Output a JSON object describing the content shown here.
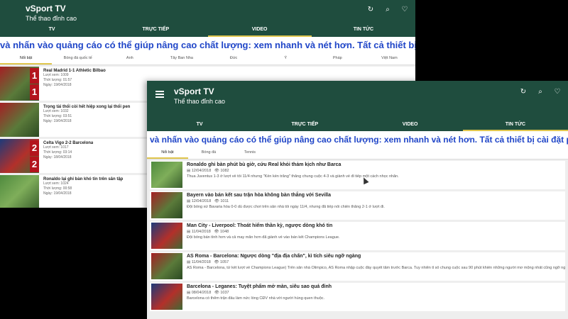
{
  "app": {
    "title": "vSport TV",
    "subtitle": "Thể thao đỉnh cao"
  },
  "icons": {
    "refresh": "↻",
    "search": "⌕",
    "favorite": "♡"
  },
  "colors": {
    "appbar": "#1f4d3e",
    "accent": "#e0c64d",
    "marquee": "#2046c8",
    "score": "#b3141d"
  },
  "tabs": [
    "TV",
    "TRỰC TIẾP",
    "VIDEO",
    "TIN TỨC"
  ],
  "back_window": {
    "active_tab": "VIDEO",
    "marquee": "và nhấn vào quảng cáo có thể giúp nâng cao chất lượng: xem nhanh và nét hơn. Tất cả thiết bị cài đặt phần mềm chặn q",
    "categories": [
      "Nổi bật",
      "Bóng đá quốc tế",
      "Anh",
      "Tây Ban Nha",
      "Đức",
      "Ý",
      "Pháp",
      "Việt Nam"
    ],
    "items": [
      {
        "title": "Real Madrid 1-1 Athletic Bilbao",
        "views": "Lượt xem: 1009",
        "duration": "Thời lượng: 01:57",
        "date": "Ngày: 19/04/2018"
      },
      {
        "title": "Trọng tài thổi còi hết hiệp xong lại thổi pen",
        "views": "Lượt xem: 1032",
        "duration": "Thời lượng: 03:51",
        "date": "Ngày: 19/04/2018"
      },
      {
        "title": "Celta Vigo 2-2 Barcelona",
        "views": "Lượt xem: 1017",
        "duration": "Thời lượng: 03:14",
        "date": "Ngày: 18/04/2018",
        "score_top": "2",
        "score_bottom": "2"
      },
      {
        "title": "Ronaldo lại ghi bàn khó tin trên sân tập",
        "views": "Lượt xem: 1024",
        "duration": "Thời lượng: 00:58",
        "date": "Ngày: 19/04/2018"
      }
    ],
    "first_item_score": {
      "top": "1",
      "bottom": "1"
    }
  },
  "front_window": {
    "active_tab": "TIN TỨC",
    "marquee": "và nhấn vào quảng cáo có thể giúp nâng cao chất lượng: xem nhanh và nét hơn. Tất cả thiết bị cài đặt phần mềm chặn q",
    "categories": [
      "Nổi bật",
      "Bóng đá",
      "Tennis"
    ],
    "items": [
      {
        "title": "Ronaldo ghi bàn phút bù giờ, cứu Real khỏi thảm kịch như Barca",
        "date": "12/04/2018",
        "views": "1082",
        "desc": "Thua Juventus 1-3 ở lượt về tối 11/4 nhưng \"Kền kền trắng\" thắng chung cuộc 4-3 và giành vé đi tiếp một cách nhọc nhằn."
      },
      {
        "title": "Bayern vào bán kết sau trận hòa không bàn thắng với Sevilla",
        "date": "12/04/2018",
        "views": "1011",
        "desc": "Đội bóng xứ Bavaria hòa 0-0 dù được chơi trên sân nhà tối ngày 11/4, nhưng đã tiếp nối chiến thắng 2-1 ở lượt đi."
      },
      {
        "title": "Man City - Liverpool: Thoát hiểm thần kỳ, ngược dòng khó tin",
        "date": "11/04/2018",
        "views": "1048",
        "desc": "Đội bóng bán tính hơn và cả may mắn hơn đã giành vé vào bán kết Champions League."
      },
      {
        "title": "AS Roma - Barcelona: Ngược dòng \"địa địa chấn\", kì tích siêu ngỡ ngàng",
        "date": "11/04/2018",
        "views": "1057",
        "desc": "AS Roma - Barcelona, tứ kết lượt về Champions League) Trên sân nhà Olimpico, AS Roma nhập cuộc đầy quyết tâm trước Barca. Tuy nhiên tỉ số chung cuộc sau 90 phút khiến những người mơ mộng nhất cũng ngỡ ngàng."
      },
      {
        "title": "Barcelona - Leganes: Tuyệt phẩm mở màn, siêu sao quá đỉnh",
        "date": "08/04/2018",
        "views": "1037",
        "desc": "Barcelona có thêm trận đấu làm nức lòng CĐV nhà với người hùng quen thuộc."
      }
    ]
  }
}
